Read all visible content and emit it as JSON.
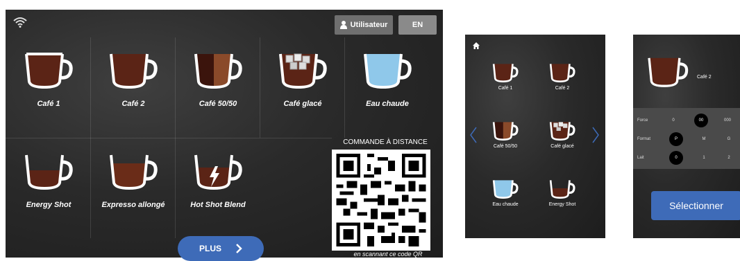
{
  "main": {
    "user_label": "Utilisateur",
    "lang_label": "EN",
    "drinks": [
      {
        "label": "Café 1",
        "fill": "coffee"
      },
      {
        "label": "Café 2",
        "fill": "coffee"
      },
      {
        "label": "Café 50/50",
        "fill": "half"
      },
      {
        "label": "Café glacé",
        "fill": "iced"
      },
      {
        "label": "Eau chaude",
        "fill": "water"
      },
      {
        "label": "Energy Shot",
        "fill": "shot"
      },
      {
        "label": "Expresso allongé",
        "fill": "long"
      },
      {
        "label": "Hot Shot Blend",
        "fill": "blend"
      }
    ],
    "remote_title": "COMMANDE À DISTANCE",
    "qr_caption": "en scannant ce code QR",
    "plus_label": "PLUS"
  },
  "screen2": {
    "drinks": [
      {
        "label": "Café 1"
      },
      {
        "label": "Café 2"
      },
      {
        "label": "Café 50/50"
      },
      {
        "label": "Café glacé"
      },
      {
        "label": "Eau chaude"
      },
      {
        "label": "Energy Shot"
      }
    ]
  },
  "screen3": {
    "drink_name": "Café 2",
    "rows": [
      {
        "label": "Force",
        "options": [
          "0",
          "00",
          "000"
        ],
        "selected": 1
      },
      {
        "label": "Format",
        "options": [
          "P",
          "M",
          "G"
        ],
        "selected": 0
      },
      {
        "label": "Lait",
        "options": [
          "0",
          "1",
          "2"
        ],
        "selected": 0
      }
    ],
    "select_label": "Sélectionner"
  },
  "colors": {
    "accent": "#3e6bb8",
    "coffee": "#5b2416",
    "water": "#8fc8ea"
  }
}
